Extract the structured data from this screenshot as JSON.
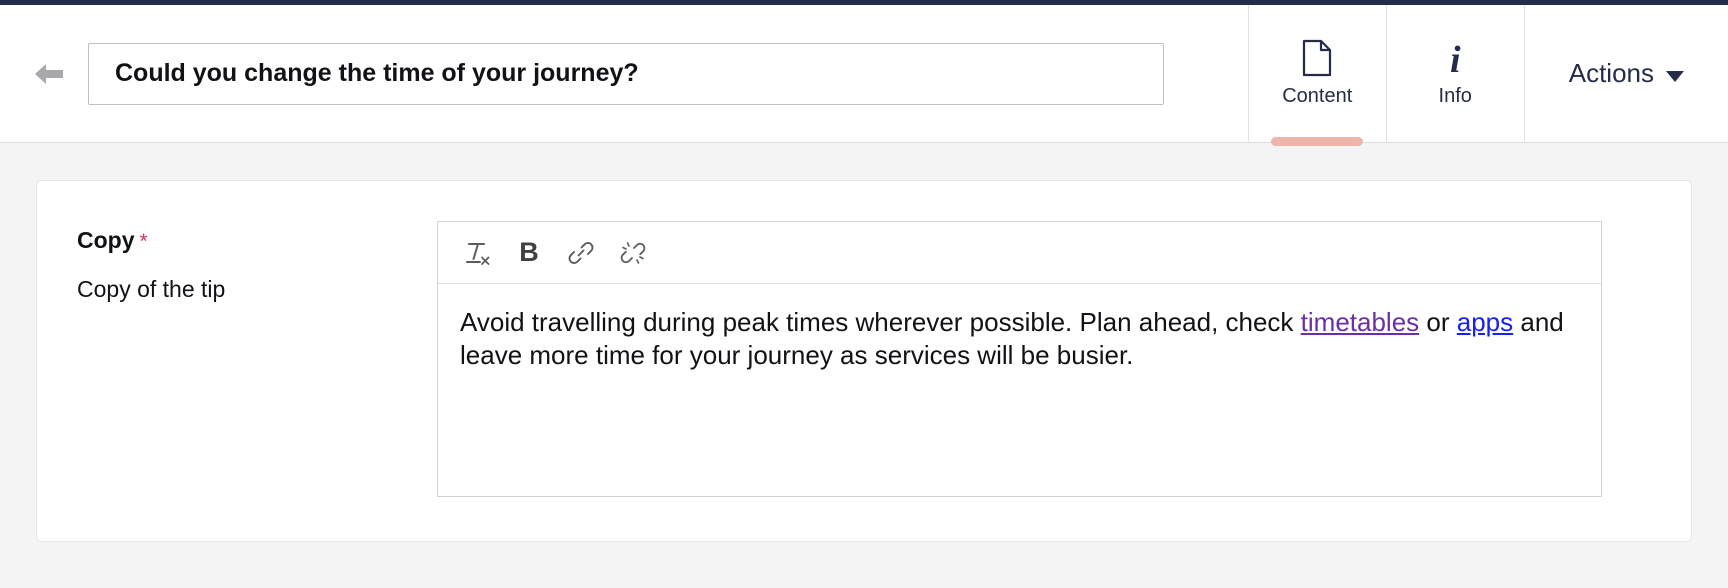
{
  "header": {
    "back_icon": "arrow-left-icon",
    "title_value": "Could you change the time of your journey?",
    "title_placeholder": "Title",
    "tabs": [
      {
        "label": "Content",
        "icon": "document-icon",
        "active": true
      },
      {
        "label": "Info",
        "icon": "info-italic-icon",
        "active": false
      }
    ],
    "actions": {
      "label": "Actions",
      "caret_icon": "chevron-down-icon"
    },
    "active_indicator_color": "#eeb5ab"
  },
  "form": {
    "field": {
      "label": "Copy",
      "required_marker": "*",
      "required_color": "#d6335d",
      "help_text": "Copy of the tip"
    },
    "editor": {
      "toolbar": [
        {
          "name": "remove-format-icon",
          "label": "Remove format"
        },
        {
          "name": "bold-icon",
          "label": "B"
        },
        {
          "name": "link-icon",
          "label": "Link"
        },
        {
          "name": "unlink-icon",
          "label": "Unlink"
        }
      ],
      "content": {
        "segment_1": "Avoid travelling during peak times wherever possible. Plan ahead, check ",
        "link_1": "timetables",
        "segment_2": " or ",
        "link_2": "apps",
        "segment_3": " and leave more time for your journey as services will be busier.",
        "link_1_color": "#6b2ea8",
        "link_2_color": "#1522ee"
      }
    }
  },
  "theme": {
    "top_bar_color": "#252c49",
    "page_background": "#f4f4f5",
    "card_background": "#ffffff"
  }
}
